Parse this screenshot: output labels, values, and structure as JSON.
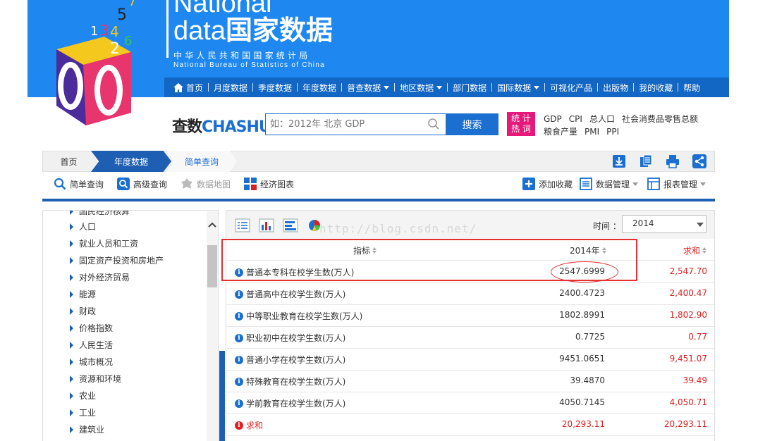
{
  "brand": {
    "en_top": "National",
    "en_data": "data",
    "cn": "国家数据",
    "sub_cn": "中华人民共和国国家统计局",
    "sub_en": "National Bureau of Statistics of China"
  },
  "logo_digits": [
    "1",
    "2",
    "3",
    "4",
    "5",
    "6",
    "7"
  ],
  "nav": {
    "items": [
      {
        "label": "首页",
        "dropdown": false
      },
      {
        "label": "月度数据",
        "dropdown": false
      },
      {
        "label": "季度数据",
        "dropdown": false
      },
      {
        "label": "年度数据",
        "dropdown": false
      },
      {
        "label": "普查数据",
        "dropdown": true
      },
      {
        "label": "地区数据",
        "dropdown": true
      },
      {
        "label": "部门数据",
        "dropdown": false
      },
      {
        "label": "国际数据",
        "dropdown": true
      },
      {
        "label": "可视化产品",
        "dropdown": false
      },
      {
        "label": "出版物",
        "dropdown": false
      },
      {
        "label": "我的收藏",
        "dropdown": false
      },
      {
        "label": "帮助",
        "dropdown": false
      }
    ]
  },
  "search": {
    "logo_cn": "查数",
    "logo_en": "CHASHU",
    "placeholder": "如：2012年 北京 GDP",
    "button": "搜索"
  },
  "hot": {
    "badge_top": "统 计",
    "badge_bottom": "热 词",
    "row1": [
      "GDP",
      "CPI",
      "总人口",
      "社会消费品零售总额"
    ],
    "row2": [
      "粮食产量",
      "PMI",
      "PPI"
    ]
  },
  "breadcrumb": {
    "home": "首页",
    "year": "年度数据",
    "simple": "简单查询"
  },
  "toolbar": {
    "simple_query": "简单查询",
    "advanced_query": "高级查询",
    "data_map": "数据地图",
    "econ_chart": "经济图表",
    "add_favorite": "添加收藏",
    "data_manage": "数据管理",
    "report_manage": "报表管理"
  },
  "sidebar": {
    "cut_item": "国民经济核算",
    "items": [
      "人口",
      "就业人员和工资",
      "固定资产投资和房地产",
      "对外经济贸易",
      "能源",
      "财政",
      "价格指数",
      "人民生活",
      "城市概况",
      "资源和环境",
      "农业",
      "工业",
      "建筑业"
    ]
  },
  "panel": {
    "time_label": "时间 ：",
    "time_value": "2014",
    "watermark": "http://blog.csdn.net/"
  },
  "table": {
    "headers": {
      "indicator": "指标",
      "year": "2014年",
      "sum": "求和"
    },
    "rows": [
      {
        "name": "普通本专科在校学生数(万人)",
        "value": "2547.6999",
        "sum": "2,547.70"
      },
      {
        "name": "普通高中在校学生数(万人)",
        "value": "2400.4723",
        "sum": "2,400.47"
      },
      {
        "name": "中等职业教育在校学生数(万人)",
        "value": "1802.8991",
        "sum": "1,802.90"
      },
      {
        "name": "职业初中在校学生数(万人)",
        "value": "0.7725",
        "sum": "0.77"
      },
      {
        "name": "普通小学在校学生数(万人)",
        "value": "9451.0651",
        "sum": "9,451.07"
      },
      {
        "name": "特殊教育在校学生数(万人)",
        "value": "39.4870",
        "sum": "39.49"
      },
      {
        "name": "学前教育在校学生数(万人)",
        "value": "4050.7145",
        "sum": "4,050.71"
      }
    ],
    "total": {
      "name": "求和",
      "value": "20,293.11",
      "sum": "20,293.11"
    }
  },
  "colors": {
    "banner": "#1e88f0",
    "nav": "#1266c4",
    "accent": "#1e5fb4",
    "hot_badge": "#e6197a",
    "sum_red": "#e02020"
  }
}
